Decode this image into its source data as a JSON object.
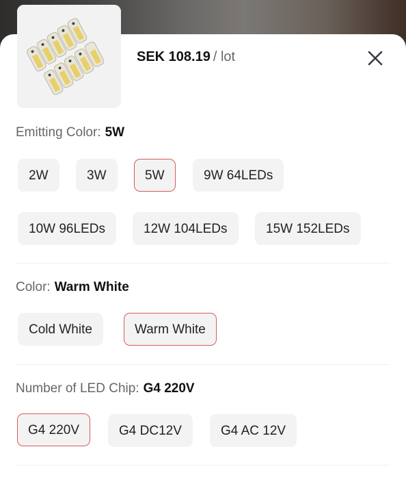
{
  "header": {
    "price": "SEK 108.19",
    "unit": "/ lot",
    "close_icon": "close-icon",
    "product_image": "led-bulbs-thumbnail"
  },
  "sections": [
    {
      "label": "Emitting Color:",
      "selected": "5W",
      "options": [
        "2W",
        "3W",
        "5W",
        "9W 64LEDs",
        "10W 96LEDs",
        "12W 104LEDs",
        "15W 152LEDs"
      ]
    },
    {
      "label": "Color:",
      "selected": "Warm White",
      "options": [
        "Cold White",
        "Warm White"
      ]
    },
    {
      "label": "Number of LED Chip:",
      "selected": "G4 220V",
      "options": [
        "G4 220V",
        "G4 DC12V",
        "G4 AC 12V"
      ]
    }
  ],
  "colors": {
    "selected_border": "#d9595b",
    "chip_bg": "#f3f3f3"
  }
}
